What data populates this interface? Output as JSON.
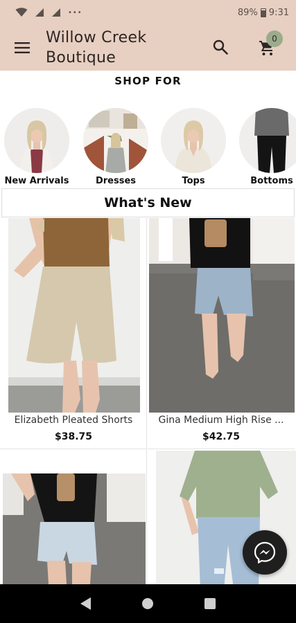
{
  "status_bar": {
    "battery": "89%",
    "time": "9:31"
  },
  "app_bar": {
    "title": "Willow Creek Boutique",
    "cart_count": "0"
  },
  "shop_for": {
    "heading": "SHOP FOR",
    "categories": [
      {
        "label": "New Arrivals"
      },
      {
        "label": "Dresses"
      },
      {
        "label": "Tops"
      },
      {
        "label": "Bottoms"
      }
    ]
  },
  "whats_new": {
    "heading": "What's New",
    "products": [
      {
        "name": "Elizabeth Pleated Shorts",
        "price": "$38.75"
      },
      {
        "name": "Gina Medium High Rise ...",
        "price": "$42.75"
      },
      {
        "name": "",
        "price": ""
      },
      {
        "name": "",
        "price": ""
      }
    ]
  },
  "colors": {
    "brand_bar": "#e7cfc1",
    "badge": "#9cab8c"
  }
}
